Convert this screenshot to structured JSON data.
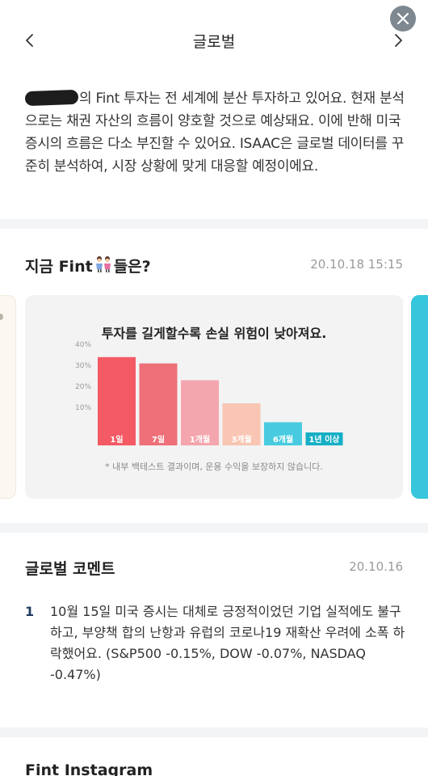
{
  "header": {
    "title": "글로벌",
    "back_icon": "chevron-left-icon",
    "next_icon": "chevron-right-icon",
    "close_icon": "close-icon"
  },
  "intro": {
    "text": "의 Fint 투자는 전 세계에 분산 투자하고 있어요. 현재 분석으로는 채권 자산의 흐름이 양호할 것으로 예상돼요. 이에 반해 미국 증시의 흐름은 다소 부진할 수 있어요. ISAAC은 글로벌 데이터를 꾸준히 분석하여, 시장 상황에 맞게 대응할 예정이에요."
  },
  "fint_now": {
    "title_prefix": "지금 Fint",
    "title_suffix": "들은?",
    "timestamp": "20.10.18 15:15",
    "card": {
      "title": "투자를 길게할수록 손실 위험이 낮아져요.",
      "note": "* 내부 백테스트 결과이며, 운용 수익을 보장하지 않습니다."
    }
  },
  "chart_data": {
    "type": "bar",
    "title": "투자를 길게할수록 손실 위험이 낮아져요.",
    "categories": [
      "1일",
      "7일",
      "1개월",
      "3개월",
      "6개월",
      "1년 이상"
    ],
    "values": [
      42,
      39,
      31,
      20,
      11,
      0
    ],
    "yticks": [
      "40%",
      "30%",
      "20%",
      "10%"
    ],
    "ylim": [
      0,
      45
    ],
    "colors": [
      "#f45a65",
      "#ee7078",
      "#f4a6ae",
      "#f8c6b3",
      "#48cbe0",
      "#15afc6"
    ]
  },
  "global_comment": {
    "title": "글로벌 코멘트",
    "date": "20.10.16",
    "items": [
      {
        "number": "1",
        "text": "10월 15일 미국 증시는 대체로 긍정적이었던 기업 실적에도 불구하고, 부양책 합의 난항과 유럽의 코로나19 재확산 우려에 소폭 하락했어요. (S&P500 -0.15%, DOW -0.07%, NASDAQ -0.47%)"
      }
    ]
  },
  "instagram": {
    "title": "Fint Instagram"
  }
}
